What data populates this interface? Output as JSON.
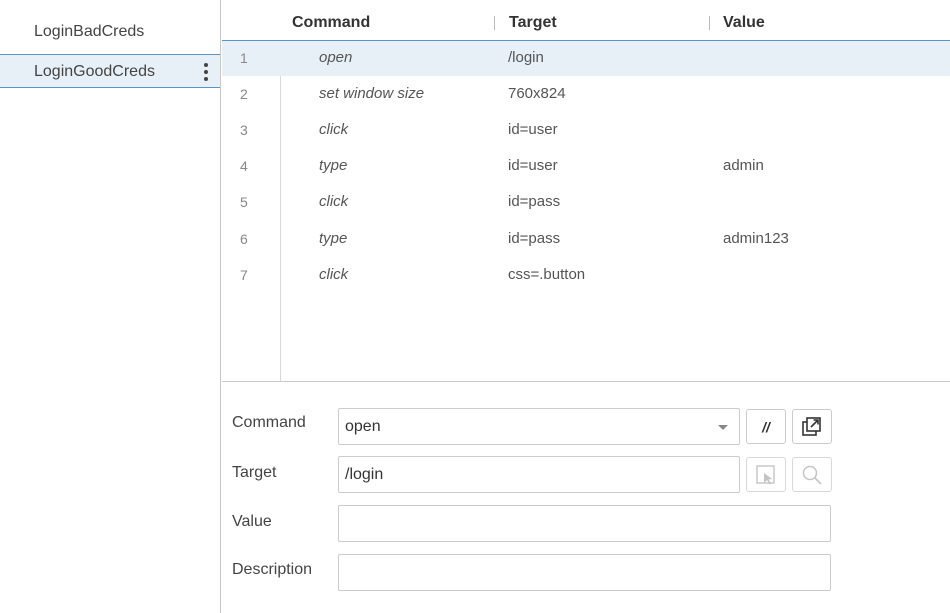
{
  "sidebar": {
    "tests": [
      {
        "name": "LoginBadCreds"
      },
      {
        "name": "LoginGoodCreds"
      }
    ]
  },
  "grid": {
    "headers": {
      "command": "Command",
      "target": "Target",
      "value": "Value"
    },
    "rows": [
      {
        "num": "1",
        "command": "open",
        "target": "/login",
        "value": ""
      },
      {
        "num": "2",
        "command": "set window size",
        "target": "760x824",
        "value": ""
      },
      {
        "num": "3",
        "command": "click",
        "target": "id=user",
        "value": ""
      },
      {
        "num": "4",
        "command": "type",
        "target": "id=user",
        "value": "admin"
      },
      {
        "num": "5",
        "command": "click",
        "target": "id=pass",
        "value": ""
      },
      {
        "num": "6",
        "command": "type",
        "target": "id=pass",
        "value": "admin123"
      },
      {
        "num": "7",
        "command": "click",
        "target": "css=.button",
        "value": ""
      }
    ]
  },
  "editor": {
    "command_label": "Command",
    "command_value": "open",
    "comment_button": "//",
    "target_label": "Target",
    "target_value": "/login",
    "value_label": "Value",
    "value_value": "",
    "description_label": "Description",
    "description_value": ""
  }
}
